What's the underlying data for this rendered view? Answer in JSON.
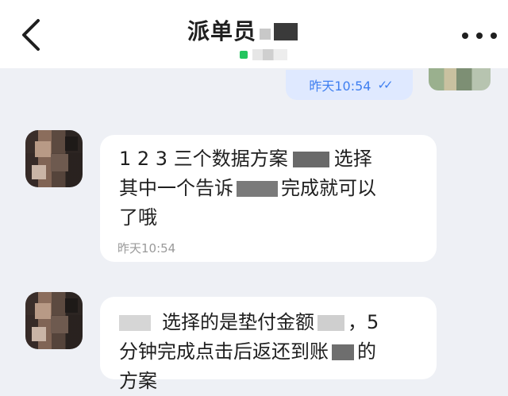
{
  "header": {
    "title": "派单员",
    "back_icon": "chevron-left-icon",
    "more_icon": "more-dots-icon",
    "online_color": "#22c55e"
  },
  "outgoing": {
    "time": "昨天10:54",
    "read_icon": "double-check-icon",
    "read_mark": "✓✓"
  },
  "messages": [
    {
      "line1_a": "1 2 3 三个数据方案",
      "line1_b": "选择",
      "line2_a": "其中一个告诉",
      "line2_b": "完成就可以",
      "line3": "了哦",
      "time": "昨天10:54"
    },
    {
      "line1_a": "选择的是垫付金额",
      "line1_b": "，5",
      "line2_a": "分钟完成点击后返还到账",
      "line2_b": "的",
      "line3": "方案"
    }
  ],
  "colors": {
    "accent": "#3f7ff0",
    "background": "#eef0f5",
    "bubble_out": "#dfe9ff",
    "bubble_in": "#ffffff"
  }
}
